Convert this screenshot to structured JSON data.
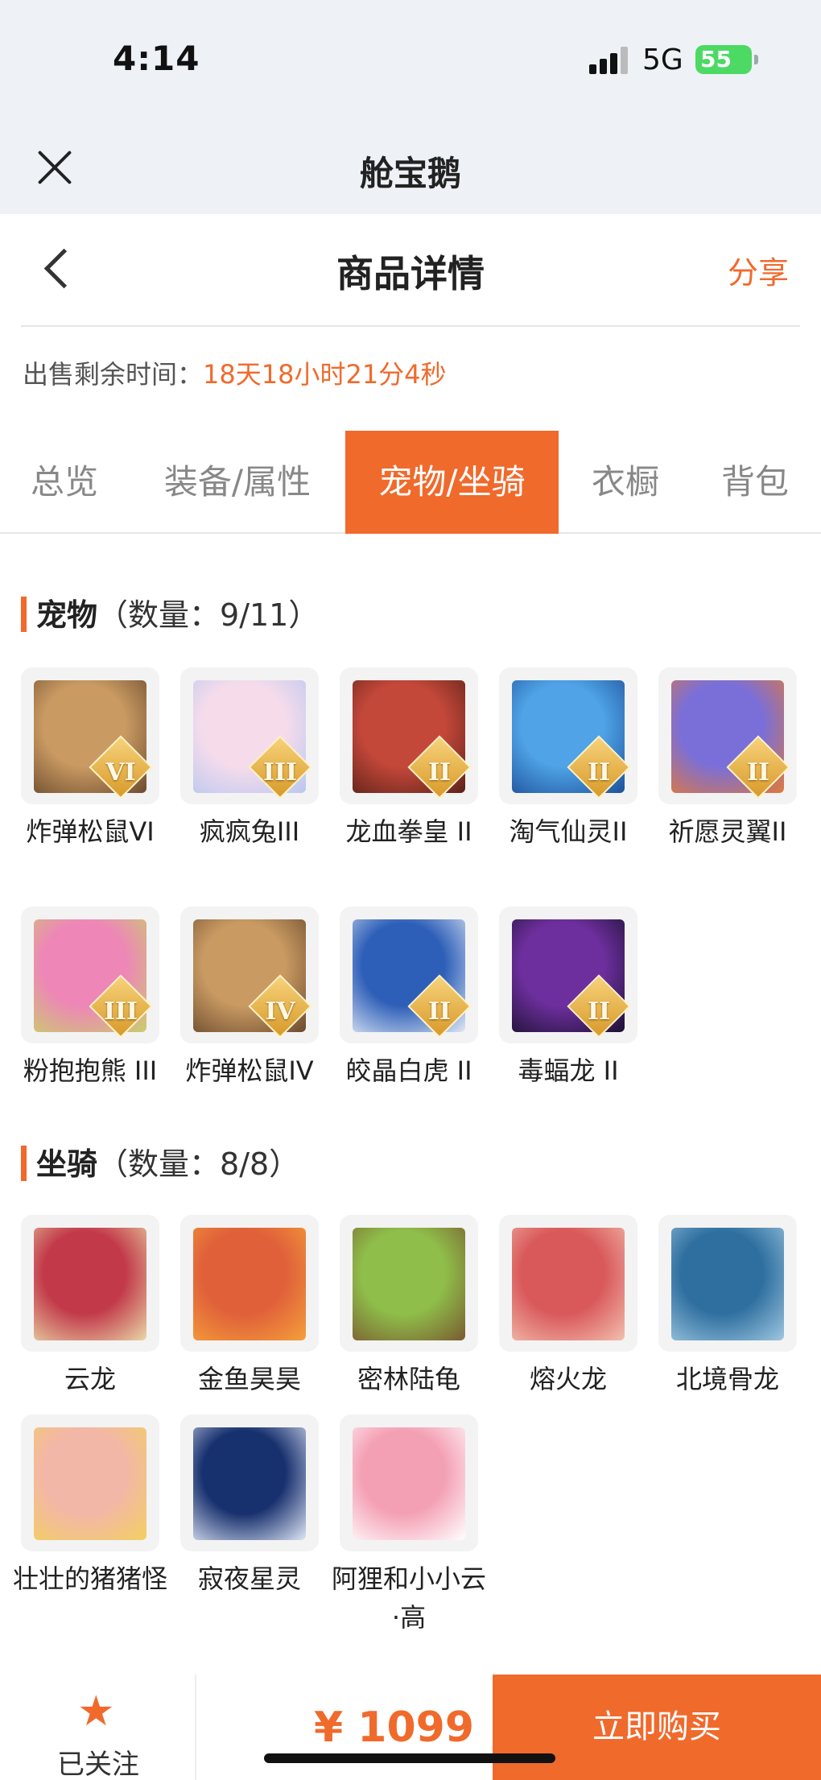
{
  "status_bar": {
    "time": "4:14",
    "network": "5G",
    "battery": "55"
  },
  "miniapp": {
    "name": "舱宝鹅"
  },
  "header": {
    "title": "商品详情",
    "share_label": "分享"
  },
  "sale": {
    "remaining_label": "出售剩余时间：",
    "remaining_time": "18天18小时21分4秒"
  },
  "tabs": [
    {
      "label": "总览",
      "active": false
    },
    {
      "label": "装备/属性",
      "active": false
    },
    {
      "label": "宠物/坐骑",
      "active": true
    },
    {
      "label": "衣橱",
      "active": false
    },
    {
      "label": "背包",
      "active": false
    }
  ],
  "pets": {
    "title": "宠物",
    "count": "（数量：9/11）",
    "items": [
      {
        "name": "炸弹松鼠VI",
        "rank": "VI",
        "colors": [
          "#c99a62",
          "#6b4a2e"
        ]
      },
      {
        "name": "疯疯兔III",
        "rank": "III",
        "colors": [
          "#f6dceb",
          "#b9c7f0"
        ]
      },
      {
        "name": "龙血拳皇 II",
        "rank": "II",
        "colors": [
          "#c4483a",
          "#5b2118"
        ]
      },
      {
        "name": "淘气仙灵II",
        "rank": "II",
        "colors": [
          "#4fa3e6",
          "#1d4f9a"
        ]
      },
      {
        "name": "祈愿灵翼II",
        "rank": "II",
        "colors": [
          "#7a6fd8",
          "#e2783a"
        ]
      },
      {
        "name": "粉抱抱熊 III",
        "rank": "III",
        "colors": [
          "#ee86b8",
          "#c8cf6a"
        ]
      },
      {
        "name": "炸弹松鼠IV",
        "rank": "IV",
        "colors": [
          "#c99a62",
          "#6b4a2e"
        ]
      },
      {
        "name": "皎晶白虎 II",
        "rank": "II",
        "colors": [
          "#2e5fb8",
          "#dfe8f5"
        ]
      },
      {
        "name": "毒蝠龙 II",
        "rank": "II",
        "colors": [
          "#6e2f9e",
          "#1b1030"
        ]
      }
    ]
  },
  "mounts": {
    "title": "坐骑",
    "count": "（数量：8/8）",
    "items": [
      {
        "name": "云龙",
        "colors": [
          "#c23a4a",
          "#e9d8a8"
        ]
      },
      {
        "name": "金鱼昊昊",
        "colors": [
          "#e0603a",
          "#f4a03a"
        ]
      },
      {
        "name": "密林陆龟",
        "colors": [
          "#8fbf4a",
          "#7a5a30"
        ]
      },
      {
        "name": "熔火龙",
        "colors": [
          "#d9585a",
          "#f2c0b0"
        ]
      },
      {
        "name": "北境骨龙",
        "colors": [
          "#2f6fa0",
          "#9fc8e0"
        ]
      },
      {
        "name": "壮壮的猪猪怪",
        "colors": [
          "#f3b7a8",
          "#f2d060"
        ]
      },
      {
        "name": "寂夜星灵",
        "colors": [
          "#17306e",
          "#dfe6f5"
        ]
      },
      {
        "name": "阿狸和小小云·高",
        "colors": [
          "#f4a0b4",
          "#ffffff"
        ]
      }
    ]
  },
  "bottom_bar": {
    "follow_label": "已关注",
    "price": "¥ 1099",
    "buy_label": "立即购买"
  },
  "accent_color": "#f06a2c"
}
